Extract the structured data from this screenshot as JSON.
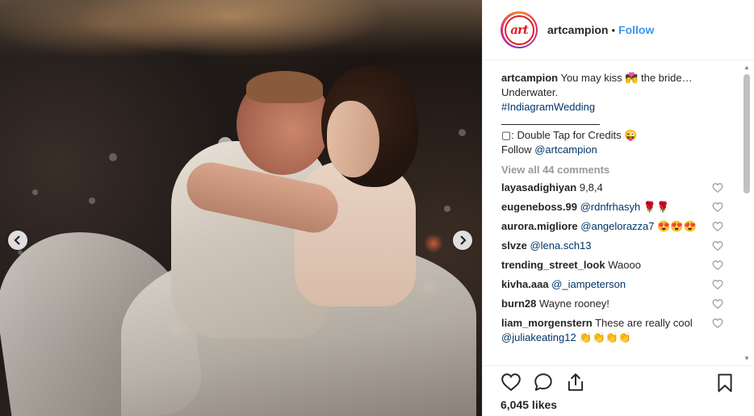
{
  "post": {
    "photo_alt": "",
    "nav": {
      "prev_icon": "chevron-left-icon",
      "next_icon": "chevron-right-icon"
    }
  },
  "header": {
    "avatar_text": "art",
    "username": "artcampion",
    "separator": "•",
    "follow_label": "Follow"
  },
  "caption": {
    "username": "artcampion",
    "text_1": "You may kiss 💏 the bride…",
    "text_2": "Underwater.",
    "hashtag": "#IndiagramWedding",
    "credits": "▢: Double Tap for Credits 😜",
    "follow_prefix": "Follow",
    "follow_mention": "@artcampion"
  },
  "view_all_label": "View all 44 comments",
  "comments": [
    {
      "user": "layasadighiyan",
      "text": "9,8,4",
      "mention": ""
    },
    {
      "user": "eugeneboss.99",
      "text": "🌹🌹",
      "mention": "@rdnfrhasyh"
    },
    {
      "user": "aurora.migliore",
      "text": "😍😍😍",
      "mention": "@angelorazza7"
    },
    {
      "user": "slvze",
      "text": "",
      "mention": "@lena.sch13"
    },
    {
      "user": "trending_street_look",
      "text": "Waooo",
      "mention": ""
    },
    {
      "user": "kivha.aaa",
      "text": "",
      "mention": "@_iampeterson"
    },
    {
      "user": "burn28",
      "text": "Wayne rooney!",
      "mention": ""
    },
    {
      "user": "liam_morgenstern",
      "text": "These are really cool",
      "mention": "@juliakeating12",
      "suffix": "👏👏👏👏"
    }
  ],
  "likes_label": "6,045 likes",
  "icons": {
    "like": "heart-icon",
    "comment": "comment-icon",
    "share": "share-icon",
    "save": "bookmark-icon"
  },
  "colors": {
    "link": "#003569",
    "follow": "#3897f0",
    "logo": "#e02020"
  }
}
